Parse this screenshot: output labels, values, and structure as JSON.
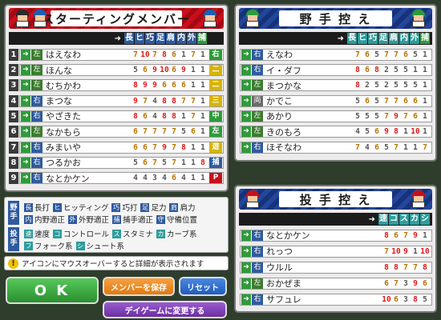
{
  "starting": {
    "title": "スターティングメンバー",
    "columns": [
      "長",
      "ヒ",
      "巧",
      "足",
      "肩",
      "内",
      "外",
      "捕"
    ],
    "column_colors": [
      "#2f5b9e",
      "#2f5b9e",
      "#2f5b9e",
      "#2f5b9e",
      "#2f5b9e",
      "#2f5b9e",
      "#2f5b9e",
      "#2e9b3a"
    ],
    "players": [
      {
        "order": "1",
        "hand": "左",
        "name": "はえなわ",
        "stats": [
          "7",
          "10",
          "7",
          "8",
          "6",
          "1",
          "7",
          "1"
        ],
        "pos": "右",
        "pos_color": "#2e9b3a"
      },
      {
        "order": "2",
        "hand": "左",
        "name": "ほんな",
        "stats": [
          "5",
          "6",
          "9",
          "10",
          "6",
          "9",
          "1",
          "1"
        ],
        "pos": "二",
        "pos_color": "#d8b400"
      },
      {
        "order": "3",
        "hand": "左",
        "name": "むちかわ",
        "stats": [
          "8",
          "9",
          "9",
          "6",
          "6",
          "6",
          "1",
          "1"
        ],
        "pos": "二",
        "pos_color": "#d8b400"
      },
      {
        "order": "4",
        "hand": "右",
        "name": "まつな",
        "stats": [
          "9",
          "7",
          "4",
          "8",
          "8",
          "7",
          "7",
          "1"
        ],
        "pos": "三",
        "pos_color": "#d8b400"
      },
      {
        "order": "5",
        "hand": "右",
        "name": "やざきた",
        "stats": [
          "8",
          "6",
          "4",
          "8",
          "8",
          "1",
          "7",
          "1"
        ],
        "pos": "中",
        "pos_color": "#2e9b3a"
      },
      {
        "order": "6",
        "hand": "左",
        "name": "なかもら",
        "stats": [
          "6",
          "7",
          "7",
          "7",
          "7",
          "5",
          "6",
          "1"
        ],
        "pos": "左",
        "pos_color": "#2e9b3a"
      },
      {
        "order": "7",
        "hand": "右",
        "name": "みまいや",
        "stats": [
          "6",
          "6",
          "7",
          "9",
          "7",
          "8",
          "1",
          "1"
        ],
        "pos": "遊",
        "pos_color": "#d8b400"
      },
      {
        "order": "8",
        "hand": "右",
        "name": "つるかお",
        "stats": [
          "5",
          "6",
          "7",
          "5",
          "7",
          "1",
          "1",
          "8"
        ],
        "pos": "捕",
        "pos_color": "#2f5b9e"
      },
      {
        "order": "9",
        "hand": "右",
        "name": "なとかケン",
        "stats": [
          "4",
          "4",
          "3",
          "4",
          "6",
          "4",
          "1",
          "1"
        ],
        "pos": "P",
        "pos_color": "#c8101c"
      }
    ]
  },
  "bench": {
    "title": "野 手 控 え",
    "columns": [
      "長",
      "ヒ",
      "巧",
      "足",
      "肩",
      "内",
      "外",
      "捕"
    ],
    "players": [
      {
        "hand": "右",
        "name": "えなわ",
        "stats": [
          "7",
          "6",
          "5",
          "7",
          "7",
          "6",
          "5",
          "1"
        ]
      },
      {
        "hand": "右",
        "name": "イ・ダフ",
        "stats": [
          "8",
          "6",
          "8",
          "2",
          "5",
          "5",
          "1",
          "1"
        ]
      },
      {
        "hand": "左",
        "name": "まつかな",
        "stats": [
          "8",
          "2",
          "5",
          "2",
          "5",
          "5",
          "5",
          "1"
        ]
      },
      {
        "hand": "両",
        "name": "かでこ",
        "stats": [
          "5",
          "6",
          "5",
          "7",
          "7",
          "6",
          "6",
          "1"
        ]
      },
      {
        "hand": "左",
        "name": "あかり",
        "stats": [
          "5",
          "5",
          "5",
          "7",
          "9",
          "7",
          "6",
          "1"
        ]
      },
      {
        "hand": "左",
        "name": "きのもろ",
        "stats": [
          "4",
          "5",
          "6",
          "9",
          "8",
          "1",
          "10",
          "1"
        ]
      },
      {
        "hand": "右",
        "name": "ほそなわ",
        "stats": [
          "7",
          "4",
          "6",
          "5",
          "7",
          "1",
          "1",
          "7"
        ]
      }
    ]
  },
  "pitchers": {
    "title": "投 手 控 え",
    "columns": [
      "速",
      "コ",
      "ス",
      "カ",
      "シ"
    ],
    "players": [
      {
        "hand": "右",
        "name": "なとかケン",
        "stats": [
          "8",
          "6",
          "7",
          "9",
          "1"
        ]
      },
      {
        "hand": "右",
        "name": "れっつ",
        "stats": [
          "7",
          "10",
          "9",
          "1",
          "10"
        ]
      },
      {
        "hand": "右",
        "name": "ウルル",
        "stats": [
          "8",
          "8",
          "7",
          "7",
          "8"
        ]
      },
      {
        "hand": "左",
        "name": "おかぜま",
        "stats": [
          "6",
          "7",
          "3",
          "9",
          "6"
        ]
      },
      {
        "hand": "右",
        "name": "サフュレ",
        "stats": [
          "10",
          "6",
          "3",
          "8",
          "5"
        ]
      }
    ]
  },
  "legend": {
    "fielder_tag": "野手",
    "pitcher_tag": "投手",
    "fielder_items": [
      {
        "key": "長",
        "label": "長打"
      },
      {
        "key": "ヒ",
        "label": "ヒッティング"
      },
      {
        "key": "巧",
        "label": "巧打"
      },
      {
        "key": "足",
        "label": "足力"
      },
      {
        "key": "肩",
        "label": "肩力"
      },
      {
        "key": "内",
        "label": "内野適正"
      },
      {
        "key": "外",
        "label": "外野適正"
      },
      {
        "key": "捕",
        "label": "捕手適正"
      },
      {
        "key": "守",
        "label": "守備位置"
      }
    ],
    "pitcher_items": [
      {
        "key": "速",
        "label": "速度"
      },
      {
        "key": "コ",
        "label": "コントロール"
      },
      {
        "key": "ス",
        "label": "スタミナ"
      },
      {
        "key": "カ",
        "label": "カーブ系"
      },
      {
        "key": "フ",
        "label": "フォーク系"
      },
      {
        "key": "シ",
        "label": "シュート系"
      }
    ]
  },
  "info_text": "アイコンにマウスオーバーすると詳細が表示されます",
  "buttons": {
    "ok": "O K",
    "save": "メンバーを保存",
    "reset": "リセット",
    "daygame": "デイゲームに変更する"
  },
  "colors": {
    "stat_high": "#e01818",
    "stat_mid": "#b87400",
    "stat_low": "#555555",
    "ok_green": "#35a83a",
    "save_orange": "#f08a18",
    "reset_blue": "#2a6bd0",
    "daygame_purple": "#7b3fb0"
  }
}
